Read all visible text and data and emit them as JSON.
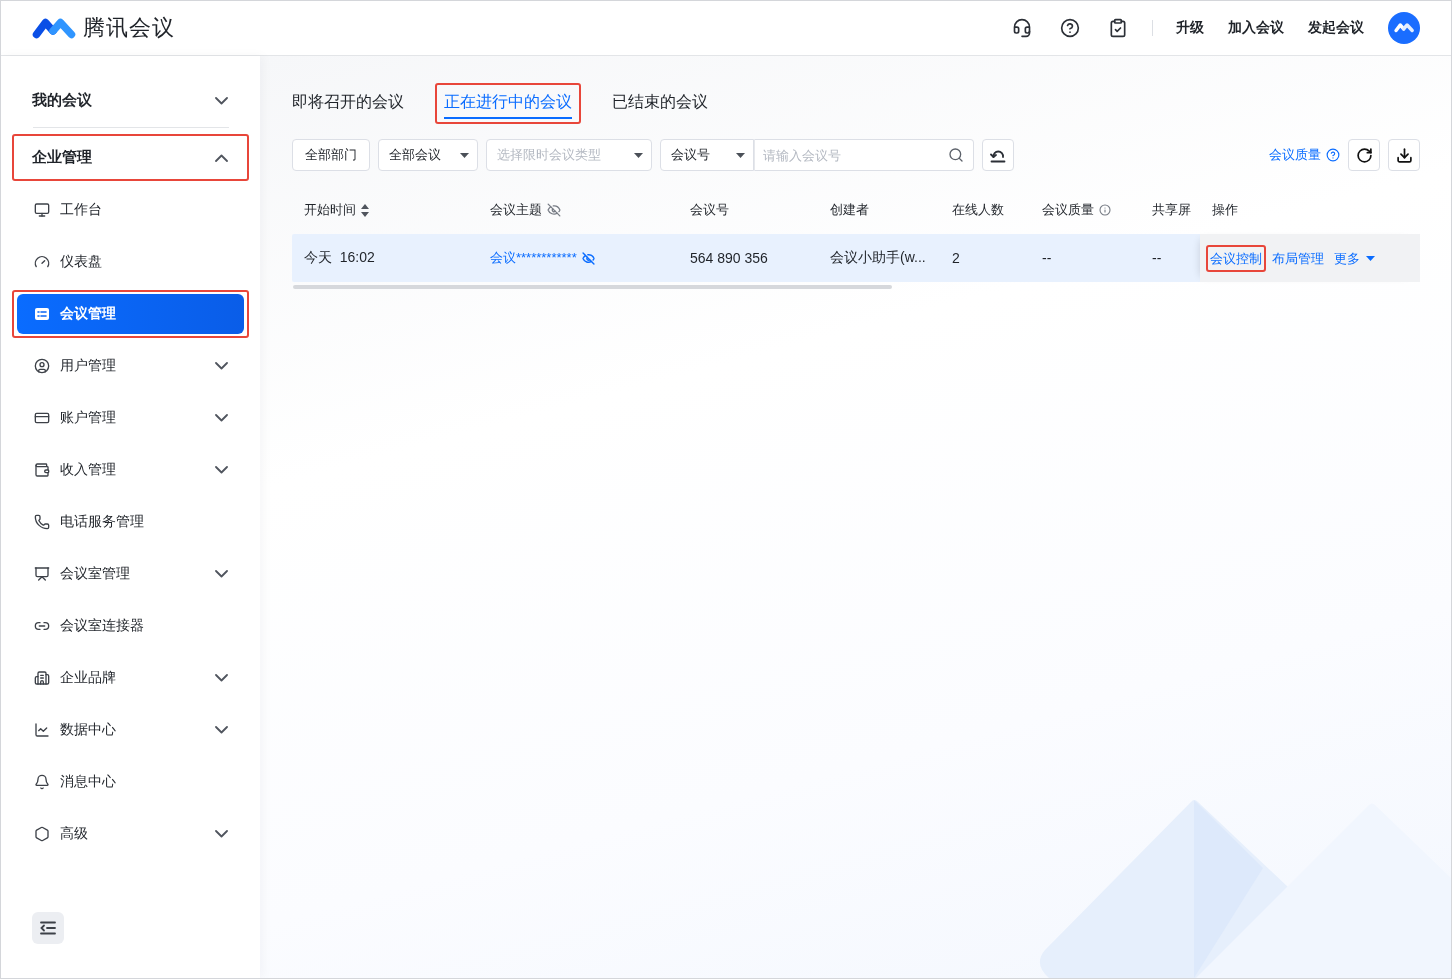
{
  "header": {
    "logo_text": "腾讯会议",
    "links": [
      "升级",
      "加入会议",
      "发起会议"
    ]
  },
  "sidebar": {
    "sections": [
      {
        "title": "我的会议",
        "expanded": false,
        "highlighted": false
      },
      {
        "title": "企业管理",
        "expanded": true,
        "highlighted": true,
        "items": [
          {
            "label": "工作台",
            "expandable": false,
            "selected": false,
            "highlighted": false
          },
          {
            "label": "仪表盘",
            "expandable": false,
            "selected": false,
            "highlighted": false
          },
          {
            "label": "会议管理",
            "expandable": false,
            "selected": true,
            "highlighted": true
          },
          {
            "label": "用户管理",
            "expandable": true,
            "selected": false,
            "highlighted": false
          },
          {
            "label": "账户管理",
            "expandable": true,
            "selected": false,
            "highlighted": false
          },
          {
            "label": "收入管理",
            "expandable": true,
            "selected": false,
            "highlighted": false
          },
          {
            "label": "电话服务管理",
            "expandable": false,
            "selected": false,
            "highlighted": false
          },
          {
            "label": "会议室管理",
            "expandable": true,
            "selected": false,
            "highlighted": false
          },
          {
            "label": "会议室连接器",
            "expandable": false,
            "selected": false,
            "highlighted": false
          },
          {
            "label": "企业品牌",
            "expandable": true,
            "selected": false,
            "highlighted": false
          },
          {
            "label": "数据中心",
            "expandable": true,
            "selected": false,
            "highlighted": false
          },
          {
            "label": "消息中心",
            "expandable": false,
            "selected": false,
            "highlighted": false
          },
          {
            "label": "高级",
            "expandable": true,
            "selected": false,
            "highlighted": false
          }
        ]
      }
    ]
  },
  "tabs": [
    {
      "label": "即将召开的会议",
      "selected": false,
      "highlighted": false
    },
    {
      "label": "正在进行中的会议",
      "selected": true,
      "highlighted": true
    },
    {
      "label": "已结束的会议",
      "selected": false,
      "highlighted": false
    }
  ],
  "filters": {
    "department": "全部部门",
    "meeting_type": {
      "value": "全部会议"
    },
    "limit_type": {
      "placeholder": "选择限时会议类型"
    },
    "search": {
      "field": "会议号",
      "placeholder": "请输入会议号"
    }
  },
  "quality_link": "会议质量",
  "table": {
    "columns": [
      {
        "label": "开始时间",
        "sortable": true
      },
      {
        "label": "会议主题",
        "sortable": false
      },
      {
        "label": "会议号",
        "sortable": false
      },
      {
        "label": "创建者",
        "sortable": false
      },
      {
        "label": "在线人数",
        "sortable": false
      },
      {
        "label": "会议质量",
        "sortable": false
      },
      {
        "label": "共享屏",
        "sortable": false
      },
      {
        "label": "操作",
        "sortable": false
      }
    ],
    "rows": [
      {
        "hovered": true,
        "cells": [
          "今天  16:02",
          "会议************",
          "564 890 356",
          "会议小助手(w...",
          "2",
          "--",
          "--"
        ],
        "actions": [
          {
            "label": "会议控制",
            "highlighted": true,
            "dropdown": false
          },
          {
            "label": "布局管理",
            "highlighted": false,
            "dropdown": false
          },
          {
            "label": "更多",
            "highlighted": false,
            "dropdown": true
          }
        ]
      }
    ]
  }
}
